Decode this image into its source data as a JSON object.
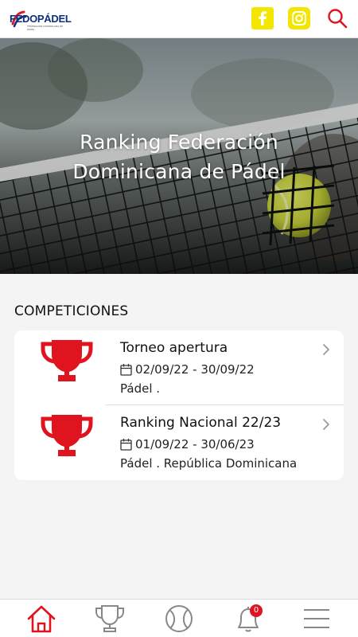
{
  "header": {
    "logo_text": "FEDOPÁDEL",
    "logo_subtext": "FEDERACIÓN DOMINICANA DE PÁDEL",
    "icons": [
      "facebook-icon",
      "instagram-icon",
      "search-icon"
    ]
  },
  "hero": {
    "title_line1": "Ranking Federación",
    "title_line2": "Dominicana de Pádel"
  },
  "competitions": {
    "section_title": "COMPETICIONES",
    "items": [
      {
        "name": "Torneo apertura",
        "dates": "02/09/22 - 30/09/22",
        "location": "Pádel ."
      },
      {
        "name": "Ranking Nacional 22/23",
        "dates": "01/09/22 - 30/06/23",
        "location": "Pádel . República Dominicana"
      }
    ]
  },
  "bottom_nav": {
    "items": [
      "home-icon",
      "trophy-icon",
      "tennis-ball-icon",
      "bell-icon",
      "menu-icon"
    ],
    "active": "home-icon",
    "notifications_count": "0"
  },
  "colors": {
    "accent": "#e0141e",
    "social_bg": "#f3e600",
    "background": "#f4f4f4"
  }
}
